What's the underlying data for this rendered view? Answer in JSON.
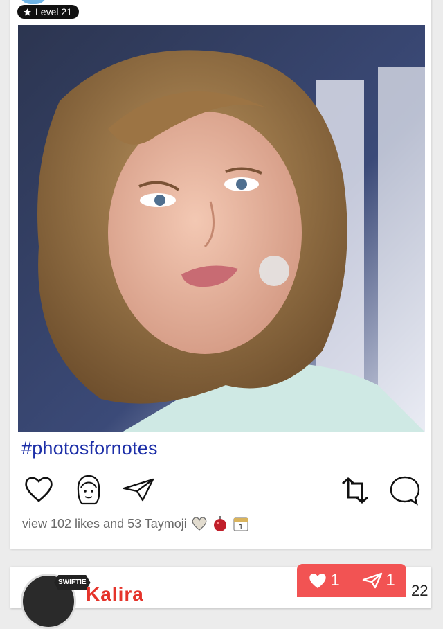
{
  "post": {
    "level_label": "Level 21",
    "hashtag": "#photosfornotes",
    "stats_text": "view 102 likes and 53 Taymoji",
    "taymoji_icons": [
      "heart-emoji-icon",
      "ornament-emoji-icon",
      "calendar-emoji-icon"
    ],
    "photo_alt": "photo"
  },
  "actions": {
    "left": [
      "heart-icon",
      "taymoji-face-icon",
      "send-icon"
    ],
    "right": [
      "repost-icon",
      "comment-icon"
    ]
  },
  "next_post": {
    "badge": "SWIFTIE",
    "name": "Kalira",
    "right_text": "22"
  },
  "action_bar": {
    "likes_count": "1",
    "shares_count": "1"
  },
  "colors": {
    "hashtag": "#1d2fa8",
    "action_bar": "#f25353",
    "name_red": "#e5332a"
  }
}
